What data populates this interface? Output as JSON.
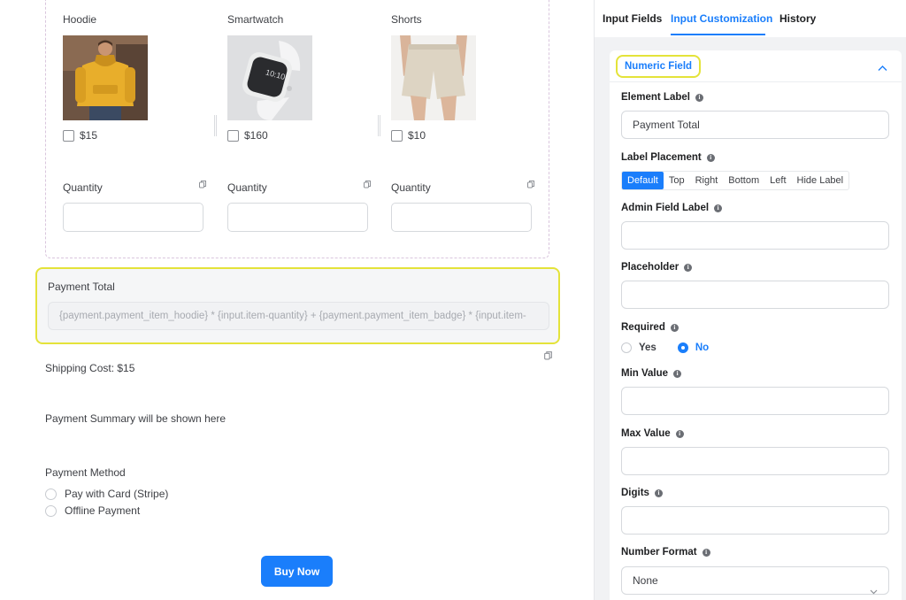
{
  "products": [
    {
      "name": "Hoodie",
      "price": "$15",
      "image": "hoodie-photo"
    },
    {
      "name": "Smartwatch",
      "price": "$160",
      "image": "smartwatch-photo"
    },
    {
      "name": "Shorts",
      "price": "$10",
      "image": "shorts-photo"
    }
  ],
  "quantity_label": "Quantity",
  "payment_total": {
    "label": "Payment Total",
    "formula": "{payment.payment_item_hoodie} * {input.item-quantity} + {payment.payment_item_badge} * {input.item-"
  },
  "shipping": "Shipping Cost: $15",
  "summary": "Payment Summary will be shown here",
  "payment_method": {
    "title": "Payment Method",
    "options": [
      "Pay with Card (Stripe)",
      "Offline Payment"
    ]
  },
  "buy_button": "Buy Now",
  "tabs": [
    "Input Fields",
    "Input Customization",
    "History"
  ],
  "active_tab": "Input Customization",
  "panel": {
    "section_title": "Numeric Field",
    "element_label": {
      "label": "Element Label",
      "value": "Payment Total"
    },
    "label_placement": {
      "label": "Label Placement",
      "options": [
        "Default",
        "Top",
        "Right",
        "Bottom",
        "Left",
        "Hide Label"
      ],
      "selected": "Default"
    },
    "admin_field_label": {
      "label": "Admin Field Label",
      "value": ""
    },
    "placeholder": {
      "label": "Placeholder",
      "value": ""
    },
    "required": {
      "label": "Required",
      "options": [
        "Yes",
        "No"
      ],
      "selected": "No"
    },
    "min_value": {
      "label": "Min Value",
      "value": ""
    },
    "max_value": {
      "label": "Max Value",
      "value": ""
    },
    "digits": {
      "label": "Digits",
      "value": ""
    },
    "number_format": {
      "label": "Number Format",
      "value": "None"
    }
  },
  "colors": {
    "accent": "#1a7efb",
    "highlight": "#e4e33a",
    "panel_bg": "#f1f2f4"
  },
  "icons": [
    "copy-icon",
    "info-icon",
    "chevron-up-icon",
    "chevron-down-icon"
  ]
}
